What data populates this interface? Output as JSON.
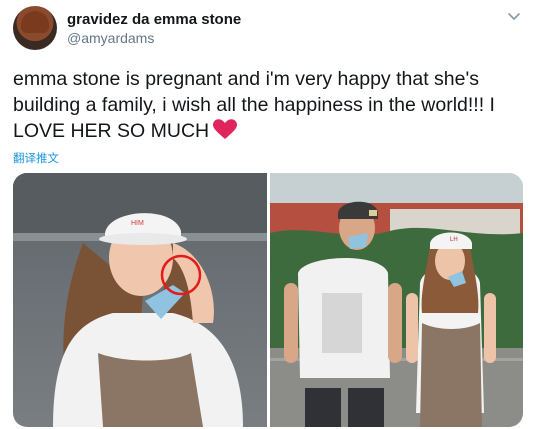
{
  "tweet": {
    "display_name": "gravidez da emma stone",
    "handle": "@amyardams",
    "text": "emma stone is pregnant and i'm very happy that she's building a family, i wish all the happiness in the world!!! I LOVE HER SO MUCH",
    "heart_icon": "red-heart-emoji",
    "translate_label": "翻译推文",
    "caret_icon": "chevron-down-icon",
    "accent_color": "#1b95e0",
    "heart_color": "#e0245e"
  },
  "media": {
    "photos": [
      {
        "subject": "woman with mask on chin",
        "cap_text": "HIM"
      },
      {
        "subject": "man and woman walking",
        "cap_text": "LH"
      }
    ]
  }
}
